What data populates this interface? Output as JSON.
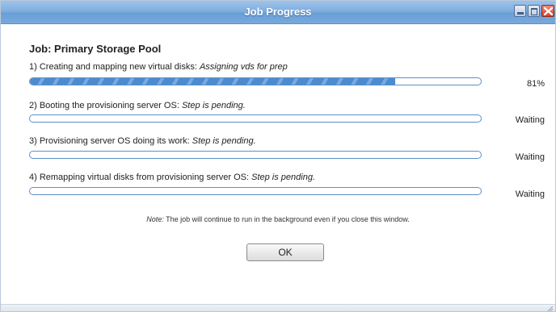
{
  "window": {
    "title": "Job Progress",
    "colors": {
      "titlebar": "#7fafe0",
      "progress": "#4b8bd0",
      "close": "#d6412a"
    }
  },
  "job": {
    "title": "Job: Primary Storage Pool"
  },
  "steps": [
    {
      "label": "1) Creating and mapping new virtual disks:",
      "detail": "Assigning vds for prep",
      "status": "81%",
      "progress": 0.81
    },
    {
      "label": "2) Booting the provisioning server OS:",
      "detail": "Step is pending.",
      "status": "Waiting",
      "progress": 0
    },
    {
      "label": "3) Provisioning server OS doing its work:",
      "detail": "Step is pending.",
      "status": "Waiting",
      "progress": 0
    },
    {
      "label": "4) Remapping virtual disks from provisioning server OS:",
      "detail": "Step is pending.",
      "status": "Waiting",
      "progress": 0
    }
  ],
  "note": {
    "prefix": "Note:",
    "text": " The job will continue to run in the background even if you close this window."
  },
  "buttons": {
    "ok_label": "OK"
  },
  "icons": {
    "minimize": "minimize-icon",
    "maximize": "maximize-icon",
    "close": "close-icon",
    "resize": "resize-grip-icon"
  }
}
